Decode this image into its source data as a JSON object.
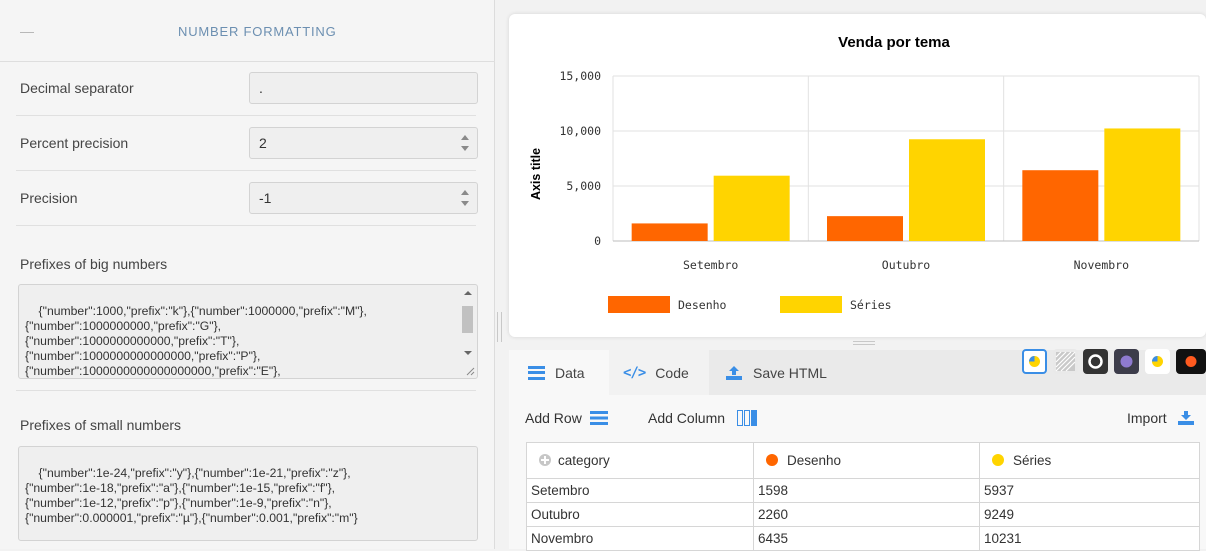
{
  "settings": {
    "section_title": "NUMBER FORMATTING",
    "decimal_separator": {
      "label": "Decimal separator",
      "value": "."
    },
    "percent_precision": {
      "label": "Percent precision",
      "value": "2"
    },
    "precision": {
      "label": "Precision",
      "value": "-1"
    },
    "big_prefixes": {
      "label": "Prefixes of big numbers",
      "value": "{\"number\":1000,\"prefix\":\"k\"},{\"number\":1000000,\"prefix\":\"M\"},\n{\"number\":1000000000,\"prefix\":\"G\"},\n{\"number\":1000000000000,\"prefix\":\"T\"},\n{\"number\":1000000000000000,\"prefix\":\"P\"},\n{\"number\":1000000000000000000,\"prefix\":\"E\"},"
    },
    "small_prefixes": {
      "label": "Prefixes of small numbers",
      "value": "{\"number\":1e-24,\"prefix\":\"y\"},{\"number\":1e-21,\"prefix\":\"z\"},\n{\"number\":1e-18,\"prefix\":\"a\"},{\"number\":1e-15,\"prefix\":\"f\"},\n{\"number\":1e-12,\"prefix\":\"p\"},{\"number\":1e-9,\"prefix\":\"n\"},\n{\"number\":0.000001,\"prefix\":\"µ\"},{\"number\":0.001,\"prefix\":\"m\"}"
    }
  },
  "chart_data": {
    "type": "bar",
    "title": "Venda por tema",
    "xlabel": "",
    "ylabel": "Axis title",
    "categories": [
      "Setembro",
      "Outubro",
      "Novembro"
    ],
    "ylim": [
      0,
      15000
    ],
    "yticks": [
      "0",
      "5,000",
      "10,000",
      "15,000"
    ],
    "ytick_values": [
      0,
      5000,
      10000,
      15000
    ],
    "grid": true,
    "legend_position": "bottom-left",
    "series": [
      {
        "name": "Desenho",
        "color": "#ff6600",
        "values": [
          1598,
          2260,
          6435
        ]
      },
      {
        "name": "Séries",
        "color": "#ffd400",
        "values": [
          5937,
          9249,
          10231
        ]
      }
    ]
  },
  "tabs": {
    "data": "Data",
    "code": "Code",
    "save": "Save HTML"
  },
  "toolbar": {
    "add_row": "Add Row",
    "add_column": "Add Column",
    "import": "Import"
  },
  "table": {
    "headers": [
      "category",
      "Desenho",
      "Séries"
    ],
    "rows": [
      [
        "Setembro",
        "1598",
        "5937"
      ],
      [
        "Outubro",
        "2260",
        "9249"
      ],
      [
        "Novembro",
        "6435",
        "10231"
      ]
    ]
  },
  "theme_icons": [
    "theme-default-icon",
    "theme-stripes-icon",
    "theme-dark-ring-icon",
    "theme-purple-icon",
    "theme-yellow-blue-icon",
    "theme-black-icon"
  ],
  "colors": {
    "accent": "#3a8ee6",
    "desenho": "#ff6600",
    "series": "#ffd400"
  }
}
